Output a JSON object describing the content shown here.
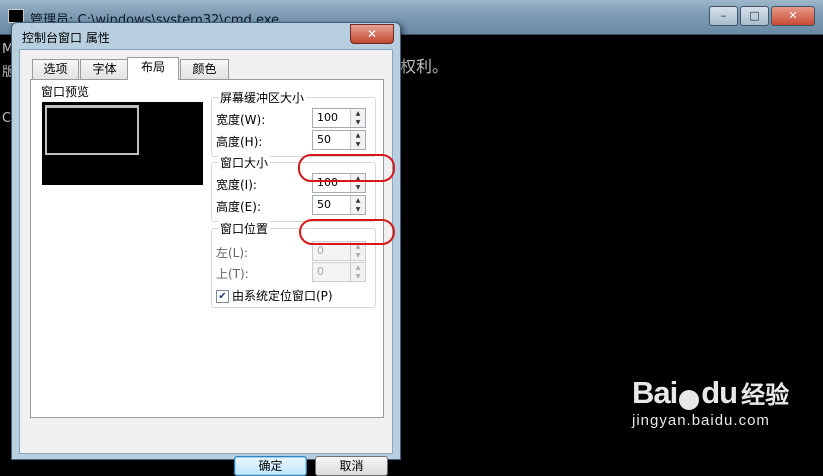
{
  "background_window": {
    "title": "管理员: C:\\windows\\system32\\cmd.exe",
    "title_buttons": [
      "–",
      "□",
      "✕"
    ],
    "console_text": "权利。",
    "left_edge_chars": [
      "M",
      "版",
      "",
      "C"
    ]
  },
  "watermark": {
    "logo_text": "Bai",
    "logo_text_2": "du",
    "brand": "经验",
    "url": "jingyan.baidu.com"
  },
  "dialog": {
    "title": "控制台窗口 属性",
    "close_label": "✕",
    "tabs": [
      {
        "label": "选项",
        "active": false
      },
      {
        "label": "字体",
        "active": false
      },
      {
        "label": "布局",
        "active": true
      },
      {
        "label": "颜色",
        "active": false
      }
    ],
    "preview_label": "窗口预览",
    "buffer_size": {
      "title": "屏幕缓冲区大小",
      "width_label": "宽度(W):",
      "width_value": "100",
      "height_label": "高度(H):",
      "height_value": "50"
    },
    "window_size": {
      "title": "窗口大小",
      "width_label": "宽度(I):",
      "width_value": "100",
      "height_label": "高度(E):",
      "height_value": "50"
    },
    "window_position": {
      "title": "窗口位置",
      "left_label": "左(L):",
      "left_value": "0",
      "top_label": "上(T):",
      "top_value": "0",
      "auto_position_label": "由系统定位窗口(P)",
      "auto_position_checked": true
    },
    "ok_label": "确定",
    "cancel_label": "取消"
  },
  "colors": {
    "highlight": "#d81818",
    "console_bg": "#000000"
  }
}
